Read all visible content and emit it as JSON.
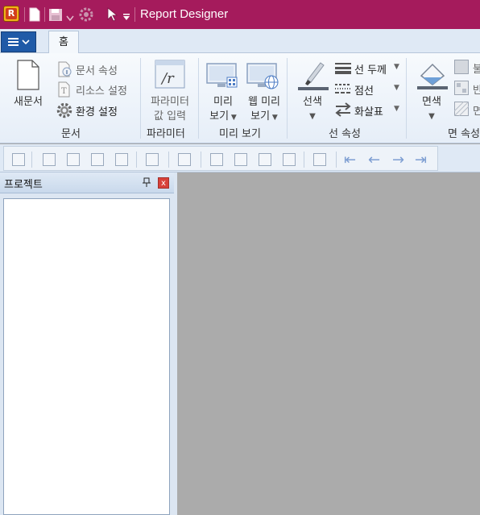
{
  "window": {
    "title": "Report Designer"
  },
  "tabs": {
    "home": "홈"
  },
  "ribbon": {
    "document_group": {
      "label": "문서",
      "new_doc": "새문서",
      "doc_props": "문서 속성",
      "resource_settings": "리소스 설정",
      "env_settings": "환경 설정"
    },
    "parameter_group": {
      "label": "파라미터",
      "param_input_line1": "파라미터",
      "param_input_line2": "값 입력"
    },
    "preview_group": {
      "label": "미리 보기",
      "preview_line1": "미리",
      "preview_line2": "보기",
      "web_preview_line1": "웹 미리",
      "web_preview_line2": "보기"
    },
    "line_group": {
      "label": "선 속성",
      "line_color": "선색",
      "line_width": "선 두께",
      "dash": "점선",
      "arrow": "화살표"
    },
    "fill_group": {
      "label": "면 속성",
      "fill_color": "면색",
      "item1": "불",
      "item2": "반",
      "item3": "면"
    }
  },
  "project_panel": {
    "title": "프로젝트",
    "close_glyph": "x"
  },
  "colors": {
    "titlebar": "#a51b5c",
    "ribbon_bg": "#e6eef8",
    "design_bg": "#ababab",
    "file_button": "#1f5aa7"
  }
}
